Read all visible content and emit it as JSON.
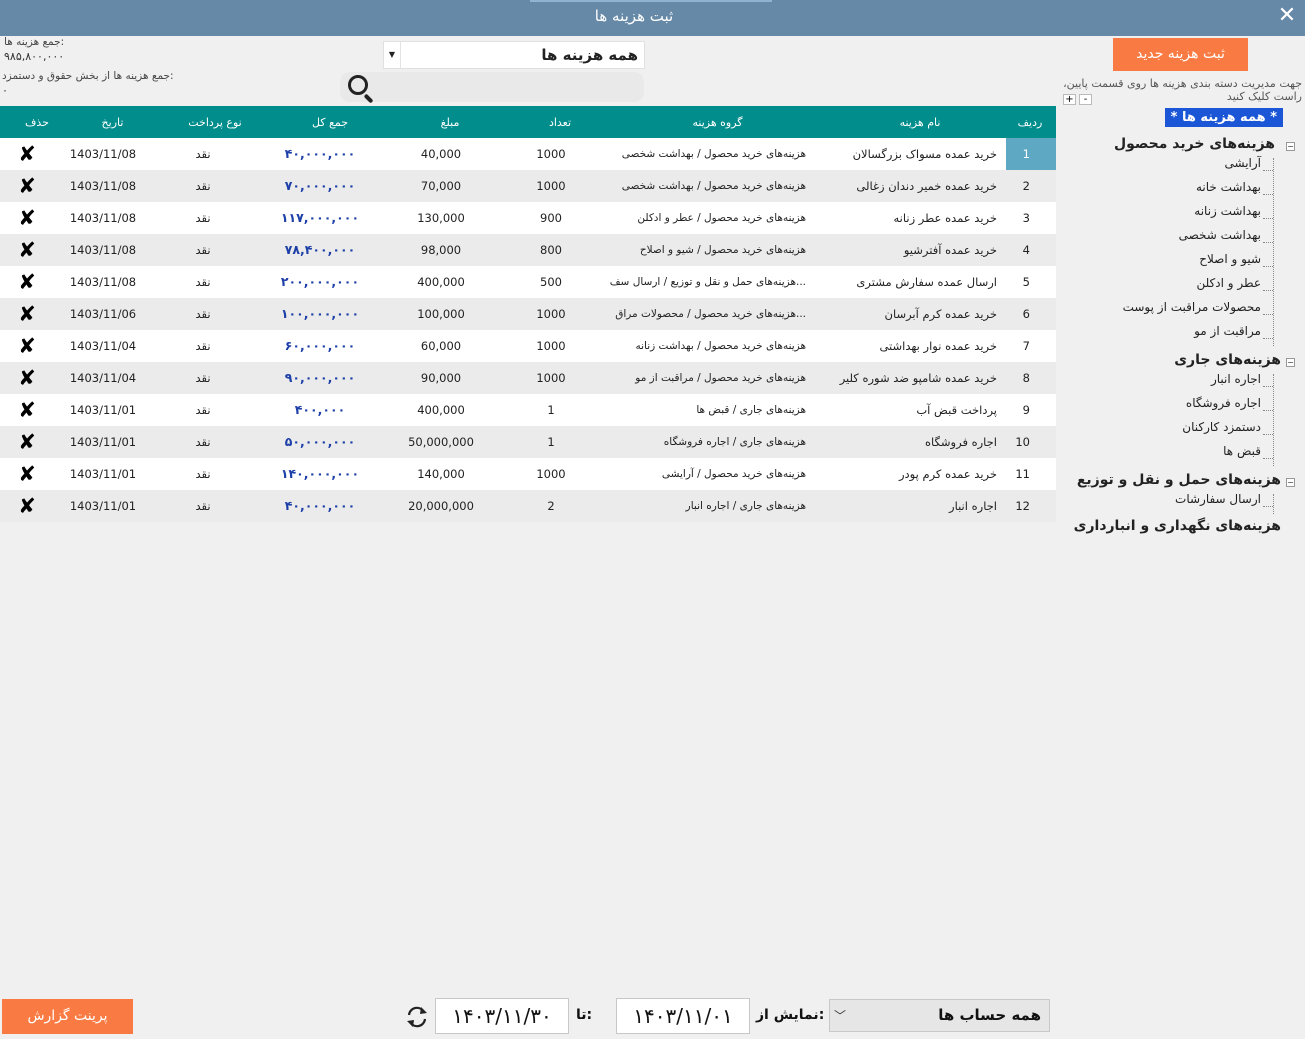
{
  "window": {
    "title": "ثبت هزینه ها",
    "close_glyph": "✕"
  },
  "summary": {
    "total_label": "جمع هزینه ها:",
    "total_value": "۹۸۵,۸۰۰,۰۰۰",
    "salary_label": "جمع هزینه ها از بخش حقوق و دستمزد:",
    "salary_value": "۰"
  },
  "filter": {
    "category_selected": "همه هزینه ها",
    "search_value": ""
  },
  "table": {
    "columns": {
      "index": "ردیف",
      "name": "نام هزینه",
      "group": "گروه هزینه",
      "count": "تعداد",
      "amount": "مبلغ",
      "total": "جمع کل",
      "payment": "نوع پرداخت",
      "date": "تاریخ",
      "delete": "حذف"
    },
    "rows": [
      {
        "index": "1",
        "name": "خرید عمده مسواک بزرگسالان",
        "group": "هزینه‌های خرید محصول / بهداشت شخصی",
        "count": "1000",
        "amount": "40,000",
        "total": "۴۰,۰۰۰,۰۰۰",
        "payment": "نقد",
        "date": "1403/11/08"
      },
      {
        "index": "2",
        "name": "خرید عمده خمیر دندان زغالی",
        "group": "هزینه‌های خرید محصول / بهداشت شخصی",
        "count": "1000",
        "amount": "70,000",
        "total": "۷۰,۰۰۰,۰۰۰",
        "payment": "نقد",
        "date": "1403/11/08"
      },
      {
        "index": "3",
        "name": "خرید عمده عطر زنانه",
        "group": "هزینه‌های خرید محصول / عطر و ادکلن",
        "count": "900",
        "amount": "130,000",
        "total": "۱۱۷,۰۰۰,۰۰۰",
        "payment": "نقد",
        "date": "1403/11/08"
      },
      {
        "index": "4",
        "name": "خرید عمده آفترشیو",
        "group": "هزینه‌های خرید محصول / شیو و اصلاح",
        "count": "800",
        "amount": "98,000",
        "total": "۷۸,۴۰۰,۰۰۰",
        "payment": "نقد",
        "date": "1403/11/08"
      },
      {
        "index": "5",
        "name": "ارسال عمده سفارش مشتری",
        "group": "هزینه‌های حمل و نقل و توزیع / ارسال سف...",
        "count": "500",
        "amount": "400,000",
        "total": "۲۰۰,۰۰۰,۰۰۰",
        "payment": "نقد",
        "date": "1403/11/08"
      },
      {
        "index": "6",
        "name": "خرید عمده کرم آبرسان",
        "group": "هزینه‌های خرید محصول / محصولات مراق...",
        "count": "1000",
        "amount": "100,000",
        "total": "۱۰۰,۰۰۰,۰۰۰",
        "payment": "نقد",
        "date": "1403/11/06"
      },
      {
        "index": "7",
        "name": "خرید عمده نوار بهداشتی",
        "group": "هزینه‌های خرید محصول / بهداشت زنانه",
        "count": "1000",
        "amount": "60,000",
        "total": "۶۰,۰۰۰,۰۰۰",
        "payment": "نقد",
        "date": "1403/11/04"
      },
      {
        "index": "8",
        "name": "خرید عمده شامپو ضد شوره کلیر",
        "group": "هزینه‌های خرید محصول / مراقبت از مو",
        "count": "1000",
        "amount": "90,000",
        "total": "۹۰,۰۰۰,۰۰۰",
        "payment": "نقد",
        "date": "1403/11/04"
      },
      {
        "index": "9",
        "name": "پرداخت قبض آب",
        "group": "هزینه‌های جاری / قبض ها",
        "count": "1",
        "amount": "400,000",
        "total": "۴۰۰,۰۰۰",
        "payment": "نقد",
        "date": "1403/11/01"
      },
      {
        "index": "10",
        "name": "اجاره فروشگاه",
        "group": "هزینه‌های جاری / اجاره فروشگاه",
        "count": "1",
        "amount": "50,000,000",
        "total": "۵۰,۰۰۰,۰۰۰",
        "payment": "نقد",
        "date": "1403/11/01"
      },
      {
        "index": "11",
        "name": "خرید عمده کرم پودر",
        "group": "هزینه‌های خرید محصول / آرایشی",
        "count": "1000",
        "amount": "140,000",
        "total": "۱۴۰,۰۰۰,۰۰۰",
        "payment": "نقد",
        "date": "1403/11/01"
      },
      {
        "index": "12",
        "name": "اجاره انبار",
        "group": "هزینه‌های جاری / اجاره انبار",
        "count": "2",
        "amount": "20,000,000",
        "total": "۴۰,۰۰۰,۰۰۰",
        "payment": "نقد",
        "date": "1403/11/01"
      }
    ],
    "selected_index": "1",
    "delete_glyph": "✘"
  },
  "sidebar": {
    "new_button": "ثبت هزینه جدید",
    "hint": "جهت مدیریت دسته بندی هزینه ها روی قسمت پایین، راست کلیک کنید",
    "plus": "+",
    "minus": "-",
    "tree": {
      "root": "* همه هزینه ها *",
      "groups": [
        {
          "label": "هزینه‌های خرید محصول",
          "toggle": "⊟",
          "children": [
            "آرایشی",
            "بهداشت خانه",
            "بهداشت زنانه",
            "بهداشت شخصی",
            "شیو و اصلاح",
            "عطر و ادکلن",
            "محصولات مراقبت از پوست",
            "مراقبت از مو"
          ]
        },
        {
          "label": "هزینه‌های جاری",
          "toggle": "⊟",
          "children": [
            "اجاره انبار",
            "اجاره فروشگاه",
            "دستمزد کارکنان",
            "قبض ها"
          ]
        },
        {
          "label": "هزینه‌های حمل و نقل و توزیع",
          "toggle": "⊟",
          "children": [
            "ارسال سفارشات"
          ]
        },
        {
          "label": "هزینه‌های نگهداری و انبارداری",
          "toggle": "",
          "children": []
        }
      ]
    }
  },
  "footer": {
    "print_button": "پرینت گزارش",
    "to_label": "تا:",
    "to_date": "۱۴۰۳/۱۱/۳۰",
    "from_label": "نمایش از:",
    "from_date": "۱۴۰۳/۱۱/۰۱",
    "account_selected": "همه حساب ها",
    "refresh_icon": "refresh-icon"
  },
  "colors": {
    "titlebar": "#6689a8",
    "table_header": "#008d8c",
    "accent_button": "#f97b43",
    "tree_selected": "#1a56d6",
    "total_text": "#1d3fa8",
    "row_selected": "#5ea8c3"
  }
}
